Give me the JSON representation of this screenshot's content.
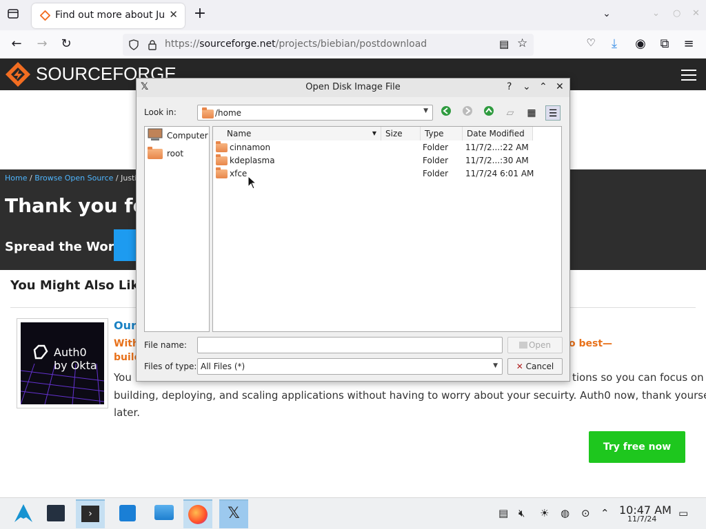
{
  "browser": {
    "tab_title": "Find out more about Justin",
    "url_domain": "sourceforge.net",
    "url_prefix": "https://",
    "url_path": "/projects/biebian/postdownload",
    "new_tab": "+"
  },
  "page": {
    "logo": "SOURCEFORGE",
    "breadcrumb_home": "Home",
    "breadcrumb_sep": " / ",
    "breadcrumb_browse": "Browse Open Source",
    "breadcrumb_rest": " / Justi",
    "thanks": "Thank you for",
    "spread": "Spread the Word:",
    "also_like": "You Might Also Like",
    "ad": {
      "logo_line1": "Auth0",
      "logo_line2": "by Okta",
      "title": "Our",
      "sub1": "With",
      "sub2": "build",
      "sub_right": "o best—",
      "body1": "You",
      "body_right": "tions so you can focus on",
      "body2": "building, deploying, and scaling applications without having to worry about your secuirty. Auth0 now, thank yourself",
      "body3": "later.",
      "cta": "Try free now"
    }
  },
  "dialog": {
    "title": "Open Disk Image File",
    "help": "?",
    "look_in_label": "Look in:",
    "look_in_value": "/home",
    "places": [
      {
        "label": "Computer"
      },
      {
        "label": "root"
      }
    ],
    "columns": [
      "Name",
      "Size",
      "Type",
      "Date Modified"
    ],
    "files": [
      {
        "name": "cinnamon",
        "size": "",
        "type": "Folder",
        "modified": "11/7/2...:22 AM"
      },
      {
        "name": "kdeplasma",
        "size": "",
        "type": "Folder",
        "modified": "11/7/2...:30 AM"
      },
      {
        "name": "xfce",
        "size": "",
        "type": "Folder",
        "modified": "11/7/24 6:01 AM"
      }
    ],
    "file_name_label": "File name:",
    "file_name_value": "",
    "files_of_type_label": "Files of type:",
    "files_of_type_value": "All Files (*)",
    "open_label": "Open",
    "cancel_label": "Cancel"
  },
  "taskbar": {
    "time": "10:47 AM",
    "date": "11/7/24"
  },
  "colors": {
    "sf_orange": "#f26d21",
    "link_blue": "#1a82c4",
    "cta_green": "#1ec71e"
  }
}
